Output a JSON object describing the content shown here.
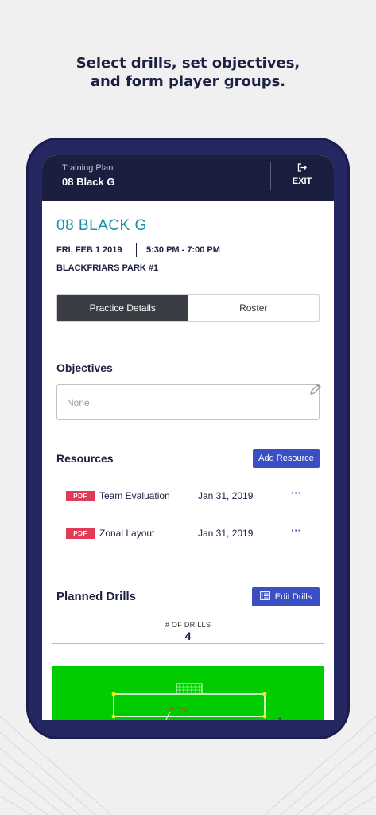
{
  "headline": {
    "line1": "Select drills, set objectives,",
    "line2": "and form player groups."
  },
  "topbar": {
    "subtitle": "Training Plan",
    "team_name": "08 Black G",
    "exit_label": "EXIT",
    "exit_icon": "exit-icon"
  },
  "event": {
    "title": "08 BLACK G",
    "date": "FRI, FEB 1 2019",
    "time": "5:30 PM - 7:00 PM",
    "location": "BLACKFRIARS PARK #1"
  },
  "tabs": [
    {
      "label": "Practice Details",
      "active": true
    },
    {
      "label": "Roster",
      "active": false
    }
  ],
  "objectives": {
    "heading": "Objectives",
    "placeholder": "None",
    "edit_icon": "pencil-icon"
  },
  "resources": {
    "heading": "Resources",
    "add_label": "Add Resource",
    "items": [
      {
        "badge": "PDF",
        "name": "Team Evaluation",
        "date": "Jan 31, 2019",
        "more": "···"
      },
      {
        "badge": "PDF",
        "name": "Zonal Layout",
        "date": "Jan 31, 2019",
        "more": "···"
      }
    ]
  },
  "drills": {
    "heading": "Planned Drills",
    "edit_label": "Edit Drills",
    "edit_icon": "list-icon",
    "count_label": "# OF DRILLS",
    "count": "4"
  },
  "colors": {
    "accent": "#3a4fc4",
    "title_teal": "#1591a8",
    "navy": "#1c2042",
    "pdf_red": "#e03a56",
    "field_green": "#00cc00"
  }
}
